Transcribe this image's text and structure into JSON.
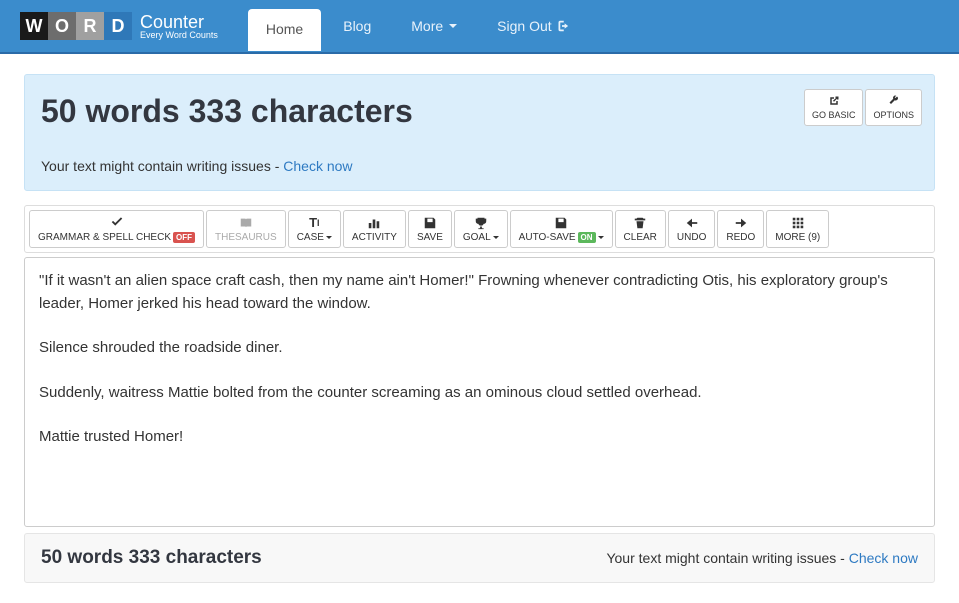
{
  "logo": {
    "letters": [
      "W",
      "O",
      "R",
      "D"
    ],
    "title": "Counter",
    "subtitle": "Every Word Counts"
  },
  "nav": {
    "home": "Home",
    "blog": "Blog",
    "more": "More",
    "signout": "Sign Out"
  },
  "header": {
    "count_text": "50 words 333 characters",
    "issue_prefix": "Your text might contain writing issues - ",
    "issue_link": "Check now",
    "go_basic": "GO BASIC",
    "options": "OPTIONS"
  },
  "toolbar": {
    "grammar": "GRAMMAR & SPELL CHECK",
    "grammar_status": "OFF",
    "thesaurus": "THESAURUS",
    "case": "CASE",
    "activity": "ACTIVITY",
    "save": "SAVE",
    "goal": "GOAL",
    "autosave": "AUTO-SAVE",
    "autosave_status": "ON",
    "clear": "CLEAR",
    "undo": "UNDO",
    "redo": "REDO",
    "more": "MORE (9)"
  },
  "text": {
    "p1": "\"If it wasn't an alien space craft cash, then my name ain't Homer!\"  Frowning whenever contradicting Otis, his exploratory group's leader, Homer jerked his head toward the window.",
    "p2": "Silence shrouded the roadside diner.",
    "p3": "Suddenly, waitress Mattie bolted from the counter screaming as an ominous cloud settled overhead.",
    "p4": "Mattie trusted Homer!"
  },
  "footer": {
    "count_text": "50 words 333 characters",
    "issue_prefix": "Your text might contain writing issues - ",
    "issue_link": "Check now"
  }
}
